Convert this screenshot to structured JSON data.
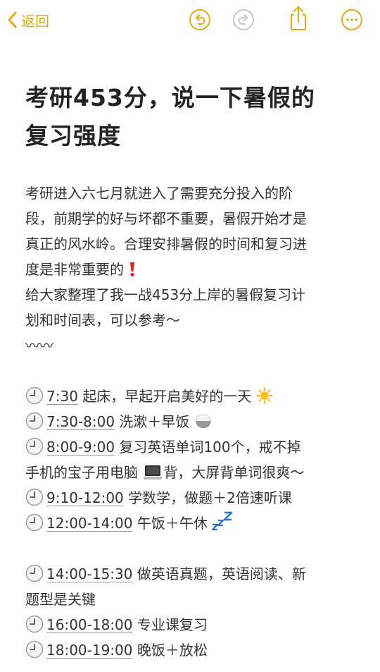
{
  "toolbar": {
    "back_label": "返回",
    "accent_color": "#e3a917",
    "icons": [
      "chevron-left-icon",
      "undo-icon",
      "redo-icon",
      "share-icon",
      "more-icon"
    ]
  },
  "note": {
    "title_lines": [
      "考研453分，说一下暑假的",
      "复习强度"
    ],
    "intro_lines": [
      "考研进入六七月就进入了需要充分投入的阶",
      "段，前期学的好与坏都不重要，暑假开始才是",
      "真正的风水岭。合理安排暑假的时间和复习进",
      "度是非常重要的"
    ],
    "intro_lines2": [
      "给大家整理了我一战453分上岸的暑假复习计",
      "划和时间表，可以参考～"
    ],
    "wave": "〰〰",
    "schedule": [
      {
        "time": "7:30",
        "text": " 起床，早起开启美好的一天",
        "icon": "sun-icon"
      },
      {
        "time": "7:30-8:00",
        "text": " 洗漱＋早饭",
        "icon": "rice-icon"
      },
      {
        "time": "8:00-9:00",
        "text": " 复习英语单词100个，戒不掉",
        "icon": ""
      },
      {
        "cont": "手机的宝子用电脑",
        "icon": "laptop-icon",
        "after": "背，大屏背单词很爽～"
      },
      {
        "time": "9:10-12:00",
        "text": " 学数学，做题＋2倍速听课",
        "icon": ""
      },
      {
        "time": "12:00-14:00",
        "text": " 午饭＋午休",
        "icon": "zzz-icon"
      }
    ],
    "schedule2": [
      {
        "time": "14:00-15:30",
        "text": " 做英语真题，英语阅读、新"
      },
      {
        "cont": "题型是关键"
      },
      {
        "time": "16:00-18:00",
        "text": " 专业课复习"
      },
      {
        "time": "18:00-19:00",
        "text": " 晚饭＋放松"
      }
    ]
  }
}
